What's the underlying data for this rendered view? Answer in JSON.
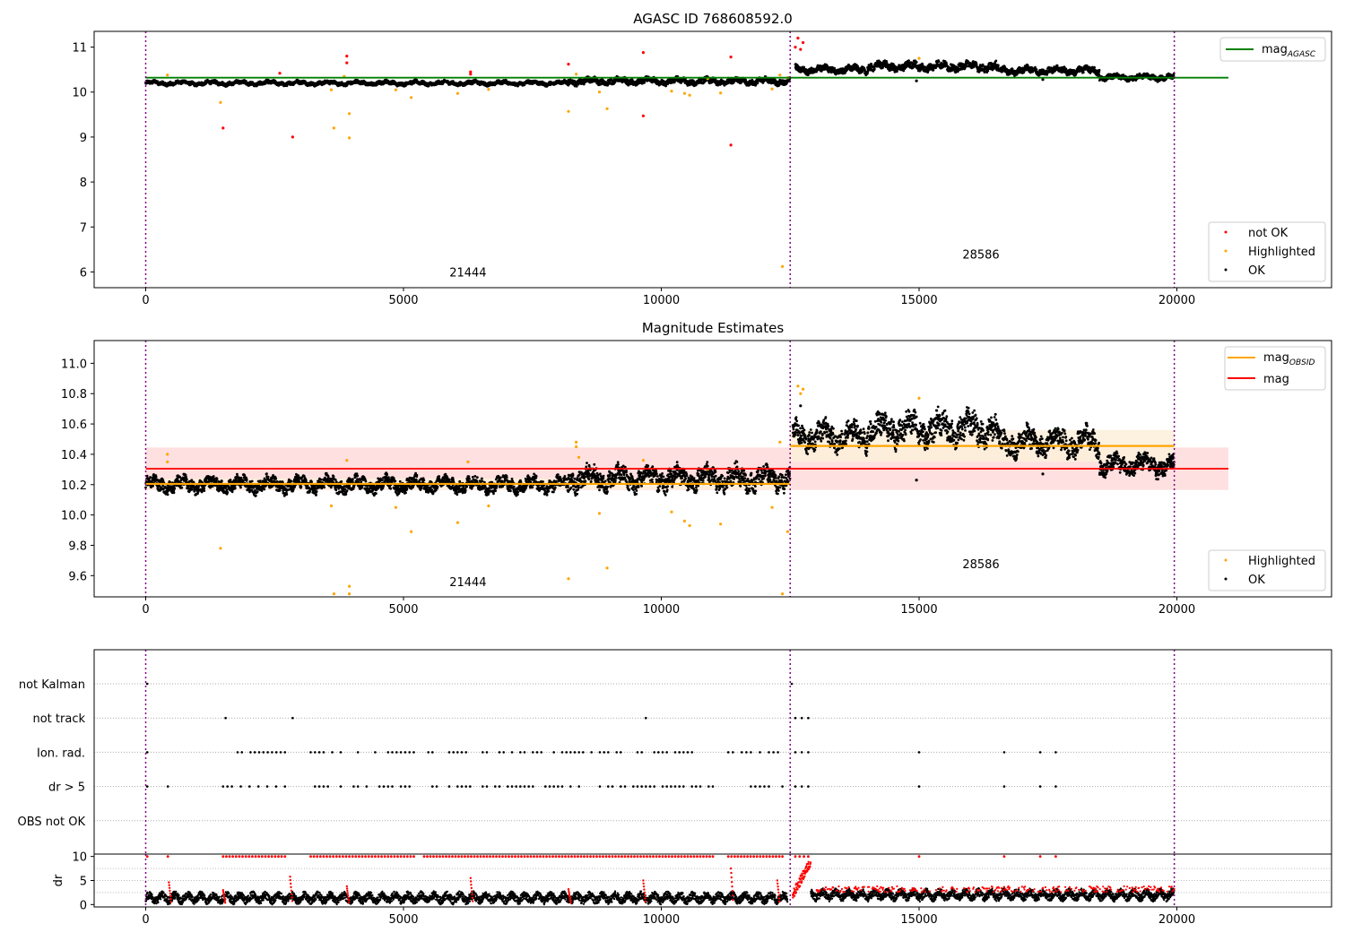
{
  "figure": {
    "title1": "AGASC ID 768608592.0",
    "title2": "Magnitude Estimates"
  },
  "colors": {
    "ok": "#000000",
    "highlighted": "#ffa500",
    "not_ok": "#ff0000",
    "mag_agasc": "#008000",
    "mag_obsid": "#ffa500",
    "mag": "#ff0000",
    "obs_boundary": "#800080",
    "mag_band": "#ffe0e0",
    "obsid_band": "#fdf0dc"
  },
  "chart_data": [
    {
      "type": "scatter",
      "title": "AGASC ID 768608592.0",
      "xlim": [
        -1000,
        23000
      ],
      "ylim": [
        5.65,
        11.35
      ],
      "xticks": [
        0,
        5000,
        10000,
        15000,
        20000
      ],
      "yticks": [
        6,
        7,
        8,
        9,
        10,
        11
      ],
      "obs_boundaries": [
        0,
        12500,
        19950
      ],
      "obsid_labels": [
        {
          "text": "21444",
          "x": 6250,
          "y": 5.9
        },
        {
          "text": "28586",
          "x": 16200,
          "y": 6.3
        }
      ],
      "lines": [
        {
          "name": "mag_AGASC",
          "label_main": "mag",
          "label_sub": "AGASC",
          "y": 10.32,
          "x": [
            0,
            21000
          ],
          "color": "#008000"
        }
      ],
      "series": [
        {
          "name": "not OK",
          "color": "#ff0000",
          "points": [
            [
              1500,
              9.2
            ],
            [
              2600,
              10.42
            ],
            [
              2850,
              9.0
            ],
            [
              3900,
              10.8
            ],
            [
              3900,
              10.65
            ],
            [
              6300,
              10.45
            ],
            [
              6300,
              10.4
            ],
            [
              8200,
              10.62
            ],
            [
              9650,
              10.88
            ],
            [
              9650,
              9.47
            ],
            [
              11350,
              10.78
            ],
            [
              11350,
              8.82
            ],
            [
              12600,
              11.0
            ],
            [
              12650,
              11.2
            ],
            [
              12700,
              10.95
            ],
            [
              12750,
              11.1
            ]
          ]
        },
        {
          "name": "Highlighted",
          "color": "#ffa500",
          "points": [
            [
              420,
              10.38
            ],
            [
              1450,
              9.77
            ],
            [
              3600,
              10.05
            ],
            [
              3650,
              9.2
            ],
            [
              3850,
              10.35
            ],
            [
              3950,
              9.52
            ],
            [
              3950,
              8.98
            ],
            [
              4850,
              10.05
            ],
            [
              5150,
              9.88
            ],
            [
              6050,
              9.97
            ],
            [
              6650,
              10.06
            ],
            [
              8200,
              9.57
            ],
            [
              8800,
              10.0
            ],
            [
              8950,
              9.63
            ],
            [
              10200,
              10.02
            ],
            [
              10450,
              9.97
            ],
            [
              10550,
              9.93
            ],
            [
              11150,
              9.98
            ],
            [
              12150,
              10.07
            ],
            [
              12300,
              10.38
            ],
            [
              12350,
              6.12
            ],
            [
              12450,
              10.32
            ],
            [
              15000,
              10.75
            ],
            [
              8350,
              10.4
            ],
            [
              10900,
              10.3
            ]
          ]
        },
        {
          "name": "OK",
          "color": "#000000",
          "band": {
            "segments": [
              {
                "x0": 0,
                "x1": 8200,
                "center": 10.2,
                "amp": 0.06
              },
              {
                "x0": 8200,
                "x1": 12500,
                "center": 10.24,
                "amp": 0.09
              },
              {
                "x0": 12600,
                "x1": 14000,
                "center": 10.5,
                "amp": 0.1
              },
              {
                "x0": 14000,
                "x1": 16500,
                "center": 10.57,
                "amp": 0.12
              },
              {
                "x0": 16500,
                "x1": 18500,
                "center": 10.48,
                "amp": 0.1
              },
              {
                "x0": 18500,
                "x1": 19950,
                "center": 10.33,
                "amp": 0.08
              }
            ]
          },
          "points": [
            [
              14950,
              10.25
            ],
            [
              17400,
              10.28
            ]
          ]
        }
      ],
      "legend_upper": {
        "entries": [
          "mag_AGASC"
        ],
        "placement": "upper right"
      },
      "legend_lower": {
        "entries": [
          "not OK",
          "Highlighted",
          "OK"
        ],
        "placement": "lower right"
      }
    },
    {
      "type": "scatter",
      "title": "Magnitude Estimates",
      "xlim": [
        -1000,
        23000
      ],
      "ylim": [
        9.46,
        11.15
      ],
      "xticks": [
        0,
        5000,
        10000,
        15000,
        20000
      ],
      "yticks": [
        9.6,
        9.8,
        10.0,
        10.2,
        10.4,
        10.6,
        10.8,
        11.0
      ],
      "obs_boundaries": [
        0,
        12500,
        19950
      ],
      "obsid_labels": [
        {
          "text": "21444",
          "x": 6250,
          "y": 9.53
        },
        {
          "text": "28586",
          "x": 16200,
          "y": 9.65
        }
      ],
      "mag": {
        "y": 10.305,
        "band": [
          10.165,
          10.445
        ],
        "x": [
          0,
          21000
        ],
        "color": "#ff0000"
      },
      "mag_obsid": [
        {
          "x0": 0,
          "x1": 12500,
          "y": 10.205,
          "band": [
            10.17,
            10.24
          ]
        },
        {
          "x0": 12500,
          "x1": 19950,
          "y": 10.455,
          "band": [
            10.35,
            10.56
          ]
        }
      ],
      "series": [
        {
          "name": "Highlighted",
          "color": "#ffa500",
          "points": [
            [
              420,
              10.4
            ],
            [
              420,
              10.35
            ],
            [
              1450,
              9.78
            ],
            [
              3600,
              10.06
            ],
            [
              3650,
              9.48
            ],
            [
              3900,
              10.36
            ],
            [
              3950,
              9.53
            ],
            [
              3950,
              9.48
            ],
            [
              4850,
              10.05
            ],
            [
              5150,
              9.89
            ],
            [
              6050,
              9.95
            ],
            [
              6250,
              10.35
            ],
            [
              6650,
              10.06
            ],
            [
              8200,
              9.58
            ],
            [
              8350,
              10.48
            ],
            [
              8350,
              10.45
            ],
            [
              8400,
              10.38
            ],
            [
              8800,
              10.01
            ],
            [
              8950,
              9.65
            ],
            [
              9650,
              10.36
            ],
            [
              10200,
              10.02
            ],
            [
              10450,
              9.96
            ],
            [
              10550,
              9.93
            ],
            [
              10900,
              10.3
            ],
            [
              11150,
              9.94
            ],
            [
              12150,
              10.05
            ],
            [
              12300,
              10.48
            ],
            [
              12350,
              9.48
            ],
            [
              12450,
              9.89
            ],
            [
              12650,
              10.85
            ],
            [
              12700,
              10.8
            ],
            [
              12750,
              10.83
            ],
            [
              15000,
              10.77
            ]
          ]
        },
        {
          "name": "OK",
          "color": "#000000",
          "band": {
            "segments": [
              {
                "x0": 0,
                "x1": 8200,
                "center": 10.2,
                "amp": 0.06
              },
              {
                "x0": 8200,
                "x1": 12500,
                "center": 10.24,
                "amp": 0.09
              },
              {
                "x0": 12550,
                "x1": 14000,
                "center": 10.52,
                "amp": 0.1
              },
              {
                "x0": 14000,
                "x1": 16500,
                "center": 10.57,
                "amp": 0.12
              },
              {
                "x0": 16500,
                "x1": 18500,
                "center": 10.48,
                "amp": 0.1
              },
              {
                "x0": 18500,
                "x1": 19950,
                "center": 10.33,
                "amp": 0.08
              }
            ]
          },
          "points": [
            [
              14950,
              10.23
            ],
            [
              17400,
              10.27
            ],
            [
              12700,
              10.72
            ]
          ]
        }
      ],
      "legend_upper": {
        "entries": [
          "mag_OBSID",
          "mag"
        ],
        "labels": {
          "mag_OBSID_main": "mag",
          "mag_OBSID_sub": "OBSID",
          "mag": "mag"
        },
        "placement": "upper right"
      },
      "legend_lower": {
        "entries": [
          "Highlighted",
          "OK"
        ],
        "placement": "lower right"
      }
    },
    {
      "type": "scatter",
      "title": "",
      "xlim": [
        -1000,
        23000
      ],
      "xticks": [
        0,
        5000,
        10000,
        15000,
        20000
      ],
      "obs_boundaries": [
        0,
        12500,
        19950
      ],
      "flag_rows": [
        "not Kalman",
        "not track",
        "Ion. rad.",
        "dr > 5",
        "OBS not OK"
      ],
      "flags": {
        "not Kalman": [
          [
            0,
            60
          ],
          [
            12500,
            12560
          ]
        ],
        "not track": [
          [
            1500,
            1600
          ],
          [
            2800,
            2900
          ],
          [
            9650,
            9750
          ],
          [
            12600,
            12850
          ]
        ],
        "Ion. rad.": [
          [
            20,
            40
          ],
          [
            1700,
            2700
          ],
          [
            3200,
            5200
          ],
          [
            5400,
            11000
          ],
          [
            11300,
            12350
          ],
          [
            12600,
            12850
          ]
        ],
        "dr > 5": [
          [
            20,
            40
          ],
          [
            420,
            440
          ],
          [
            1500,
            2700
          ],
          [
            3200,
            5200
          ],
          [
            5400,
            11000
          ],
          [
            11300,
            12350
          ],
          [
            12600,
            12850
          ]
        ],
        "OBS not OK": []
      },
      "single_flag_points": {
        "Ion. rad.": [
          15000,
          16650,
          17350,
          17650
        ],
        "dr > 5": [
          15000,
          16650,
          17350,
          17650
        ]
      },
      "dr_panel": {
        "ylabel": "dr",
        "yticks": [
          0,
          5,
          10
        ],
        "ylim": [
          -0.5,
          10.5
        ],
        "clip_max": 10
      }
    }
  ]
}
